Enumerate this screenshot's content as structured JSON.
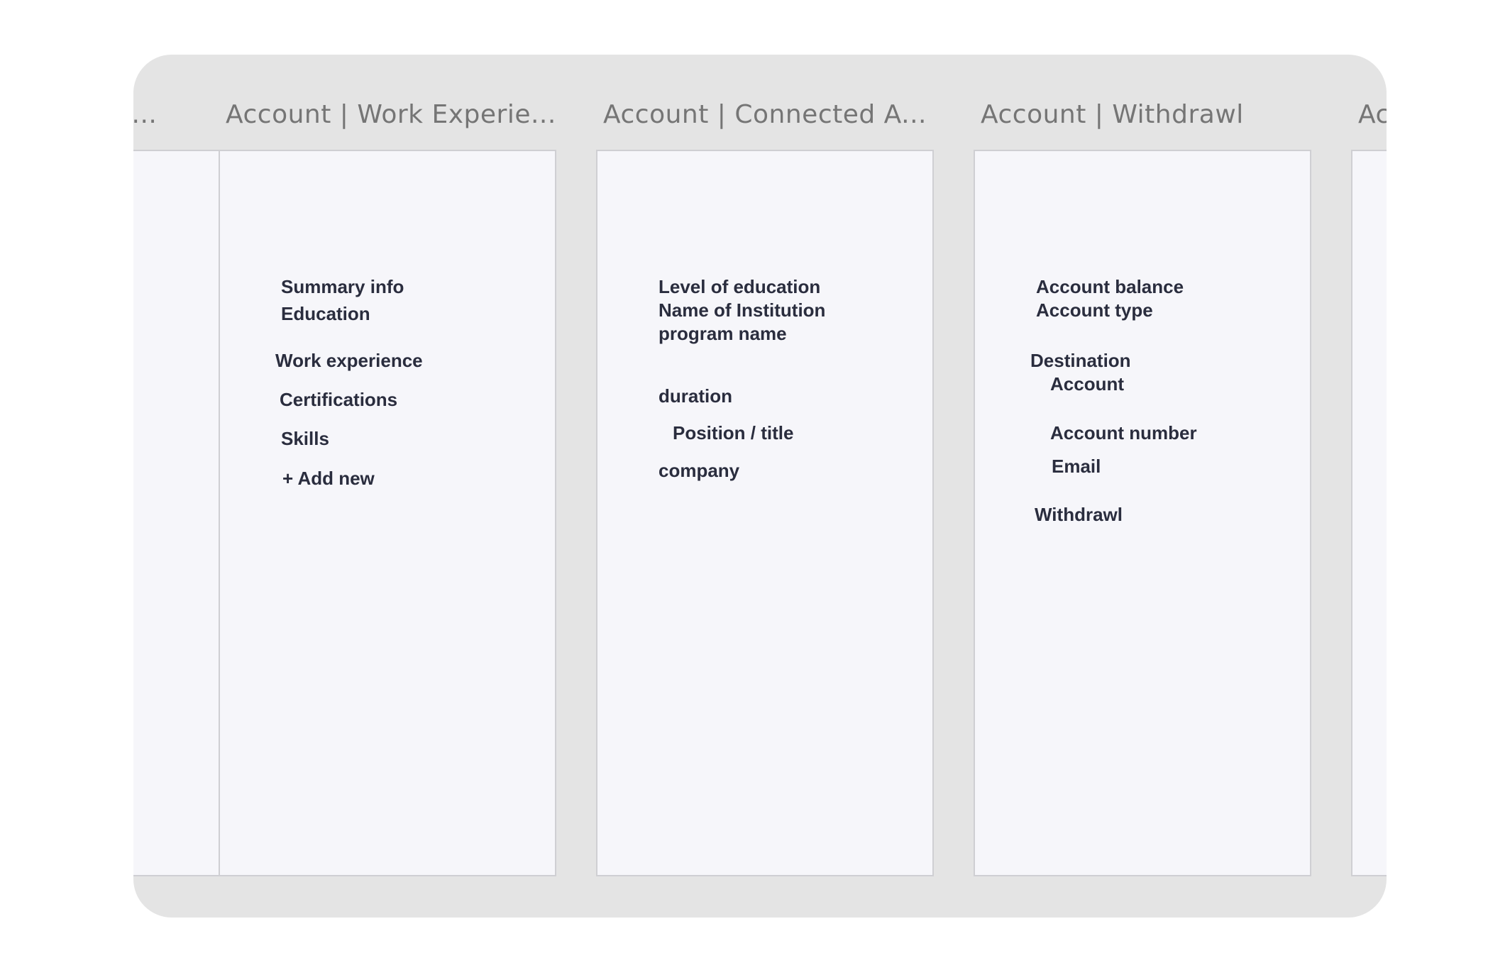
{
  "frames": [
    {
      "title": "A...",
      "items": []
    },
    {
      "title": "Account | Work Experie...",
      "items": [
        "Summary info",
        "Education",
        "Work experience",
        "Certifications",
        "Skills",
        "+ Add new"
      ]
    },
    {
      "title": "Account | Connected A...",
      "items": [
        "Level of education",
        "Name of Institution",
        "program name",
        "duration",
        "Position / title",
        "company"
      ]
    },
    {
      "title": "Account | Withdrawl",
      "items": [
        "Account balance",
        "Account type",
        "Destination",
        "Account",
        "Account number",
        "Email",
        "Withdrawl"
      ]
    },
    {
      "title": "Ac",
      "items": []
    }
  ],
  "colors": {
    "canvas": "#e4e4e4",
    "artboard": "#f6f6fa",
    "title_text": "#757575",
    "label_text": "#2a2d3e"
  }
}
